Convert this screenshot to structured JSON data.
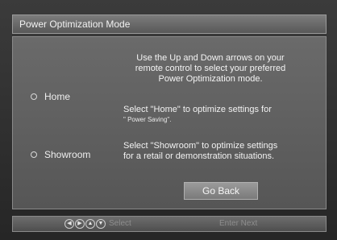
{
  "title": "Power Optimization Mode",
  "intro_lines": [
    "Use the Up and Down arrows on your",
    "remote control to select your preferred",
    "Power Optimization mode."
  ],
  "options": [
    {
      "label": "Home"
    },
    {
      "label": "Showroom"
    }
  ],
  "home_desc_line1": "Select \"Home\" to optimize settings for",
  "home_desc_line2": "\" Power Saving\".",
  "showroom_desc_lines": [
    "Select \"Showroom\" to optimize settings",
    "for a retail or demonstration situations."
  ],
  "go_back_label": "Go Back",
  "footer": {
    "select_label": "Select",
    "enter_label": "Enter Next",
    "nav_icons": [
      "left-arrow-icon",
      "right-arrow-icon",
      "up-arrow-icon",
      "down-arrow-icon"
    ]
  }
}
